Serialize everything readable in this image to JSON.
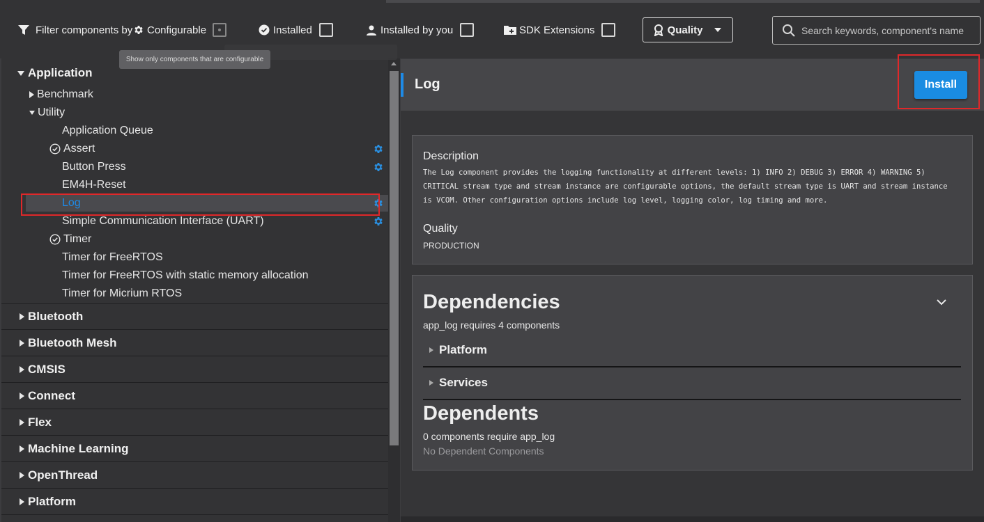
{
  "filter_bar": {
    "filter_label": "Filter components by",
    "configurable_label": "Configurable",
    "installed_label": "Installed",
    "installed_by_you_label": "Installed by you",
    "sdk_extensions_label": "SDK Extensions",
    "quality_label": "Quality",
    "search_placeholder": "Search keywords, component's name",
    "tooltip": "Show only components that are configurable"
  },
  "tree": {
    "application": {
      "label": "Application",
      "benchmark": "Benchmark",
      "utility": {
        "label": "Utility",
        "items": [
          {
            "label": "Application Queue",
            "installed": false,
            "configurable": false
          },
          {
            "label": "Assert",
            "installed": true,
            "configurable": true
          },
          {
            "label": "Button Press",
            "installed": false,
            "configurable": true
          },
          {
            "label": "EM4H-Reset",
            "installed": false,
            "configurable": false
          },
          {
            "label": "Log",
            "installed": false,
            "configurable": true,
            "selected": true
          },
          {
            "label": "Simple Communication Interface (UART)",
            "installed": false,
            "configurable": true
          },
          {
            "label": "Timer",
            "installed": true,
            "configurable": false
          },
          {
            "label": "Timer for FreeRTOS",
            "installed": false,
            "configurable": false
          },
          {
            "label": "Timer for FreeRTOS with static memory allocation",
            "installed": false,
            "configurable": false
          },
          {
            "label": "Timer for Micrium RTOS",
            "installed": false,
            "configurable": false
          }
        ]
      }
    },
    "categories": [
      "Bluetooth",
      "Bluetooth Mesh",
      "CMSIS",
      "Connect",
      "Flex",
      "Machine Learning",
      "OpenThread",
      "Platform"
    ]
  },
  "detail": {
    "title": "Log",
    "install_label": "Install",
    "description_label": "Description",
    "description_text": "The Log component provides the logging functionality at different levels: 1) INFO 2) DEBUG 3) ERROR 4) WARNING 5) CRITICAL stream type and stream instance are configurable options, the default stream type is UART and stream instance is VCOM. Other configuration options include log level, logging color, log timing and more.",
    "quality_label": "Quality",
    "quality_value": "PRODUCTION",
    "dependencies_heading": "Dependencies",
    "dependencies_summary": "app_log requires 4 components",
    "dependency_groups": [
      "Platform",
      "Services"
    ],
    "dependents_heading": "Dependents",
    "dependents_summary": "0 components require app_log",
    "dependents_empty": "No Dependent Components"
  },
  "colors": {
    "accent": "#1a8ce2",
    "highlight_box": "#e0282a",
    "selected_text": "#1e8ae6",
    "gear": "#2a8fe0"
  }
}
